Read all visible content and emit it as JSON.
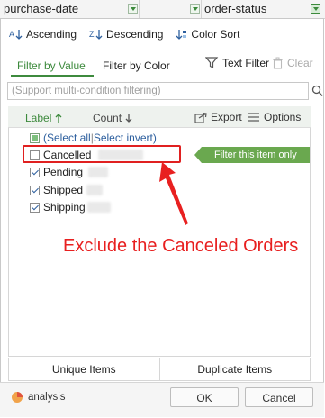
{
  "header": {
    "col1": "purchase-date",
    "col2": "order-status"
  },
  "sort": {
    "ascending": "Ascending",
    "descending": "Descending",
    "color_sort": "Color Sort"
  },
  "tabs": {
    "by_value": "Filter by Value",
    "by_color": "Filter by Color",
    "text_filter": "Text Filter",
    "clear": "Clear"
  },
  "search": {
    "placeholder": "(Support multi-condition filtering)"
  },
  "list": {
    "label_col": "Label",
    "count_col": "Count",
    "export": "Export",
    "options": "Options",
    "select_all": "(Select all",
    "divider": "|",
    "select_invert": "Select invert)",
    "items": [
      {
        "label": "Cancelled",
        "checked": false
      },
      {
        "label": "Pending",
        "checked": true
      },
      {
        "label": "Shipped",
        "checked": true
      },
      {
        "label": "Shipping",
        "checked": true
      }
    ],
    "filter_hint": "Filter this item only"
  },
  "annotation": "Exclude the Canceled Orders",
  "bottom": {
    "unique": "Unique Items",
    "duplicate": "Duplicate Items"
  },
  "footer": {
    "analysis": "analysis",
    "ok": "OK",
    "cancel": "Cancel"
  },
  "colors": {
    "accent_green": "#3d8a3d",
    "hint_green": "#6aa84f",
    "highlight_red": "#e02020"
  }
}
